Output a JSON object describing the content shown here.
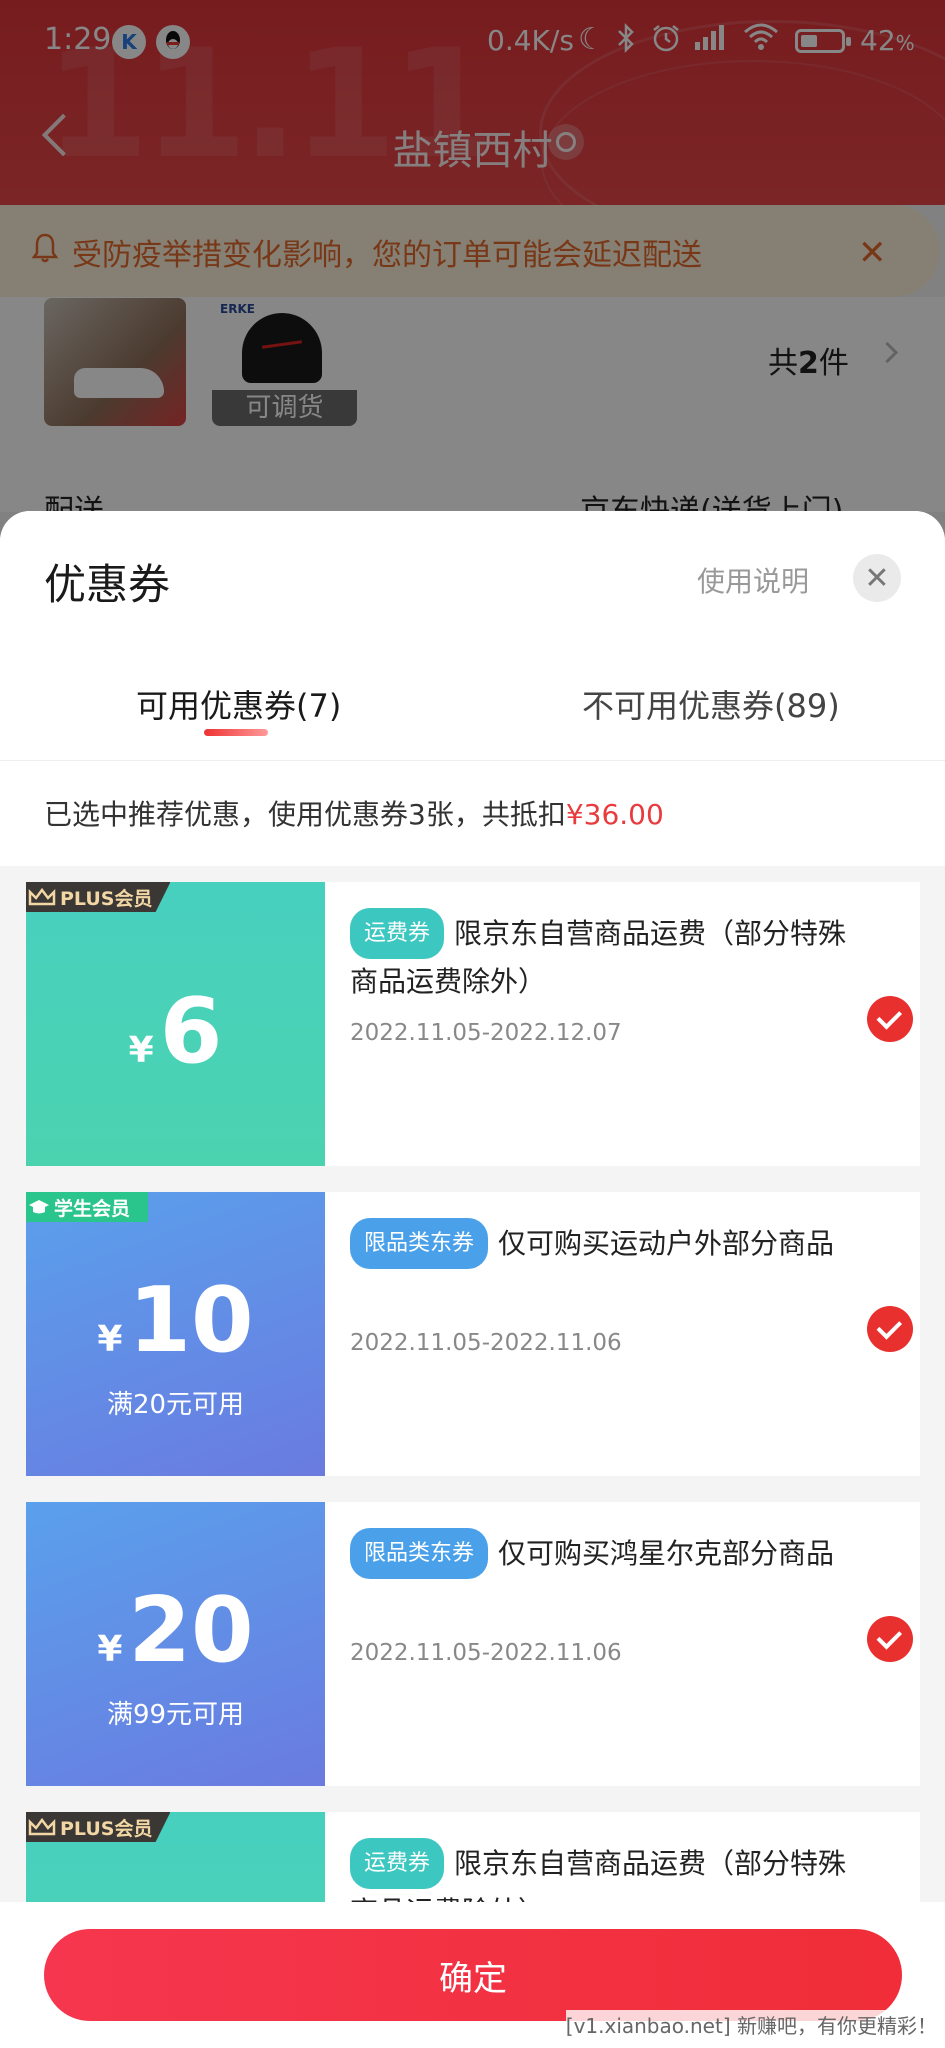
{
  "status": {
    "time": "1:29",
    "network_speed": "0.4K/s",
    "battery_percent": "42",
    "battery_level": 0.42,
    "battery_suffix": "%",
    "notification_apps": [
      "K",
      "qq-icon"
    ],
    "icons": [
      "moon-icon",
      "bluetooth-icon",
      "alarm-icon",
      "signal-icon",
      "wifi-icon"
    ]
  },
  "nav": {
    "title": "盐镇西村"
  },
  "notice": {
    "text": "受防疫举措变化影响，您的订单可能会延迟配送"
  },
  "order": {
    "thumb_tag": "可调货",
    "count_prefix": "共",
    "count_num": "2",
    "count_suffix": "件",
    "shipping_label": "配送",
    "shipping_value": "京东快递(送货上门)",
    "brand_text": "ERKE"
  },
  "sheet": {
    "title": "优惠券",
    "help": "使用说明",
    "tabs": [
      {
        "label": "可用优惠券(7)"
      },
      {
        "label": "不可用优惠券(89)"
      }
    ],
    "summary_prefix": "已选中推荐优惠，使用优惠券3张，共抵扣",
    "summary_amount": "¥36.00"
  },
  "coupons": [
    {
      "badge": "PLUS会员",
      "yen": "¥",
      "amount": "6",
      "condition": "",
      "tag": "运费券",
      "desc": "限京东自营商品运费（部分特殊商品运费除外）",
      "date": "2022.11.05-2022.12.07"
    },
    {
      "badge": "学生会员",
      "yen": "¥",
      "amount": "10",
      "condition": "满20元可用",
      "tag": "限品类东券",
      "desc": "仅可购买运动户外部分商品",
      "date": "2022.11.05-2022.11.06"
    },
    {
      "badge": "",
      "yen": "¥",
      "amount": "20",
      "condition": "满99元可用",
      "tag": "限品类东券",
      "desc": "仅可购买鸿星尔克部分商品",
      "date": "2022.11.05-2022.11.06"
    },
    {
      "badge": "PLUS会员",
      "yen": "",
      "amount": "",
      "condition": "",
      "tag": "运费券",
      "desc": "限京东自营商品运费（部分特殊商品运费除外）",
      "date": ""
    }
  ],
  "confirm_label": "确定",
  "watermark": "[v1.xianbao.net] 新赚吧，有你更精彩！",
  "colors": {
    "accent": "#e93b3d",
    "header": "#e0363a",
    "green": "#48d0bf",
    "blue": "#5f8de6"
  }
}
